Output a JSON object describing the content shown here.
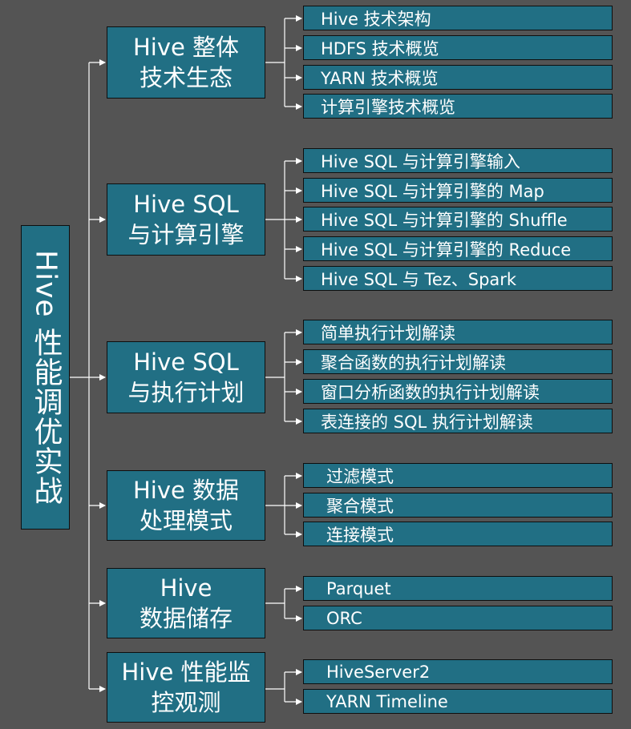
{
  "root": {
    "title": "Hive 性能调优实战"
  },
  "categories": [
    {
      "line1": "Hive 整体",
      "line2": "技术生态",
      "items": [
        "Hive 技术架构",
        "HDFS 技术概览",
        "YARN 技术概览",
        "计算引擎技术概览"
      ]
    },
    {
      "line1": "Hive SQL",
      "line2": "与计算引擎",
      "items": [
        "Hive SQL 与计算引擎输入",
        "Hive SQL 与计算引擎的 Map",
        "Hive SQL 与计算引擎的 Shuffle",
        "Hive SQL 与计算引擎的 Reduce",
        "Hive SQL 与 Tez、Spark"
      ]
    },
    {
      "line1": "Hive SQL",
      "line2": "与执行计划",
      "items": [
        "简单执行计划解读",
        "聚合函数的执行计划解读",
        "窗口分析函数的执行计划解读",
        "表连接的 SQL 执行计划解读"
      ]
    },
    {
      "line1": "Hive 数据",
      "line2": "处理模式",
      "items": [
        "过滤模式",
        "聚合模式",
        "连接模式"
      ]
    },
    {
      "line1": "Hive",
      "line2": "数据储存",
      "items": [
        "Parquet",
        "ORC"
      ]
    },
    {
      "line1": "Hive 性能监",
      "line2": "控观测",
      "items": [
        "HiveServer2",
        "YARN Timeline"
      ]
    }
  ]
}
